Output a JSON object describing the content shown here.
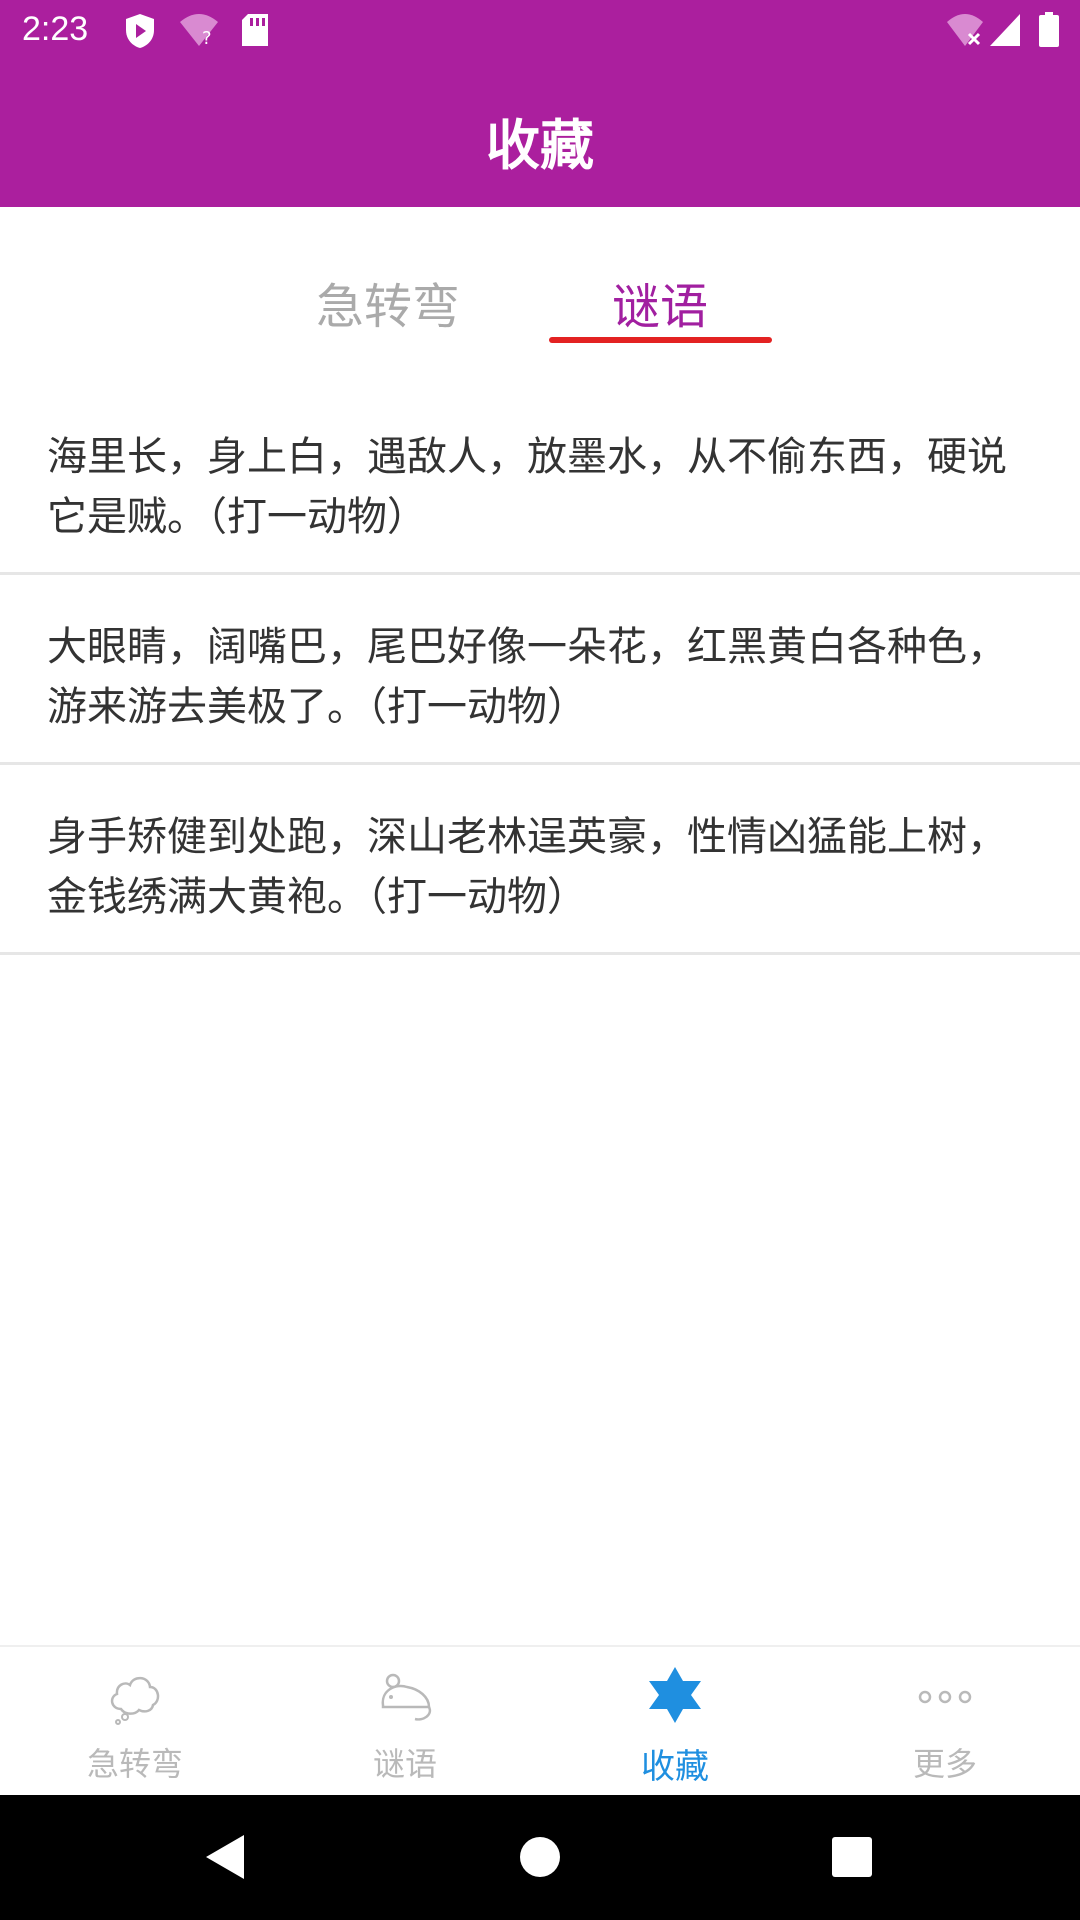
{
  "status_bar": {
    "time": "2:23",
    "icons": [
      "play-protect-icon",
      "wifi-question-icon",
      "sd-card-icon",
      "wifi-off-icon",
      "signal-icon",
      "battery-icon"
    ]
  },
  "app_bar": {
    "title": "收藏"
  },
  "tabs": [
    {
      "label": "急转弯",
      "selected": false
    },
    {
      "label": "谜语",
      "selected": true
    }
  ],
  "riddles": [
    {
      "text": "海里长，身上白，遇敌人，放墨水，从不偷东西，硬说它是贼。（打一动物）"
    },
    {
      "text": "大眼睛，阔嘴巴，尾巴好像一朵花，红黑黄白各种色，游来游去美极了。（打一动物）"
    },
    {
      "text": "身手矫健到处跑，深山老林逞英豪，性情凶猛能上树，金钱绣满大黄袍。（打一动物）"
    }
  ],
  "bottom_nav": [
    {
      "label": "急转弯",
      "icon": "cloud-icon",
      "active": false
    },
    {
      "label": "谜语",
      "icon": "mouse-icon",
      "active": false
    },
    {
      "label": "收藏",
      "icon": "star-icon",
      "active": true
    },
    {
      "label": "更多",
      "icon": "more-dots-icon",
      "active": false
    }
  ],
  "colors": {
    "primary": "#ab1f9e",
    "tab_selected": "#a11fa0",
    "tab_indicator": "#e32222",
    "nav_active": "#1f8fe0",
    "nav_inactive": "#b9b9b9"
  },
  "system_nav": [
    "back-icon",
    "home-icon",
    "recents-icon"
  ]
}
